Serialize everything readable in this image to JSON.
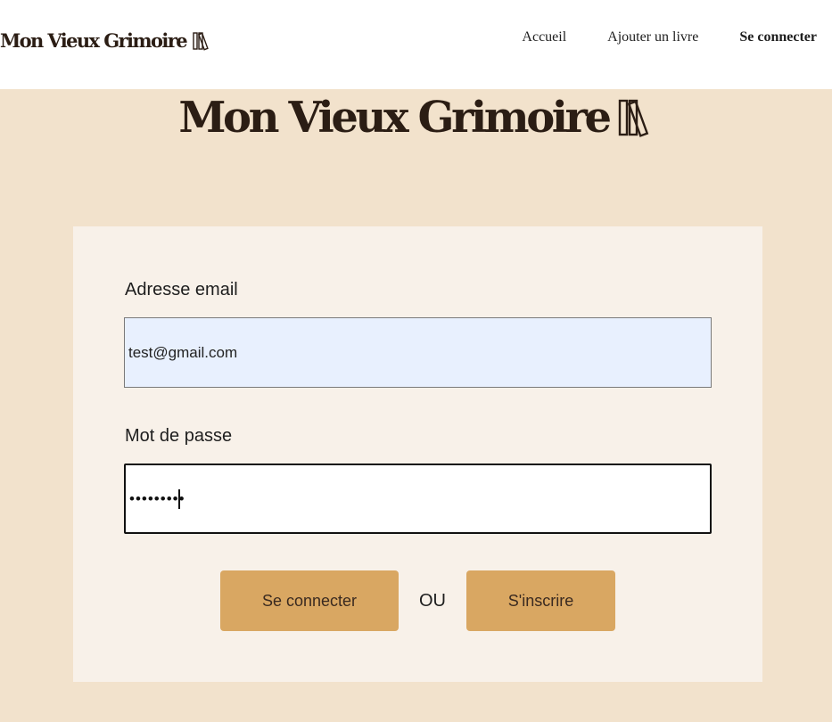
{
  "header": {
    "logo_text": "Mon Vieux Grimoire",
    "nav": [
      {
        "label": "Accueil",
        "active": false
      },
      {
        "label": "Ajouter un livre",
        "active": false
      },
      {
        "label": "Se connecter",
        "active": true
      }
    ]
  },
  "hero": {
    "title": "Mon Vieux Grimoire"
  },
  "form": {
    "email_label": "Adresse email",
    "email_value": "test@gmail.com",
    "password_label": "Mot de passe",
    "password_value": "•••••••••",
    "login_button": "Se connecter",
    "separator": "OU",
    "signup_button": "S'inscrire"
  },
  "colors": {
    "page_background": "#f2e2cc",
    "card_background": "#f8f1e9",
    "button": "#d9a762",
    "autofill": "#e8f0fe"
  },
  "icons": {
    "logo_icon": "books-icon"
  }
}
